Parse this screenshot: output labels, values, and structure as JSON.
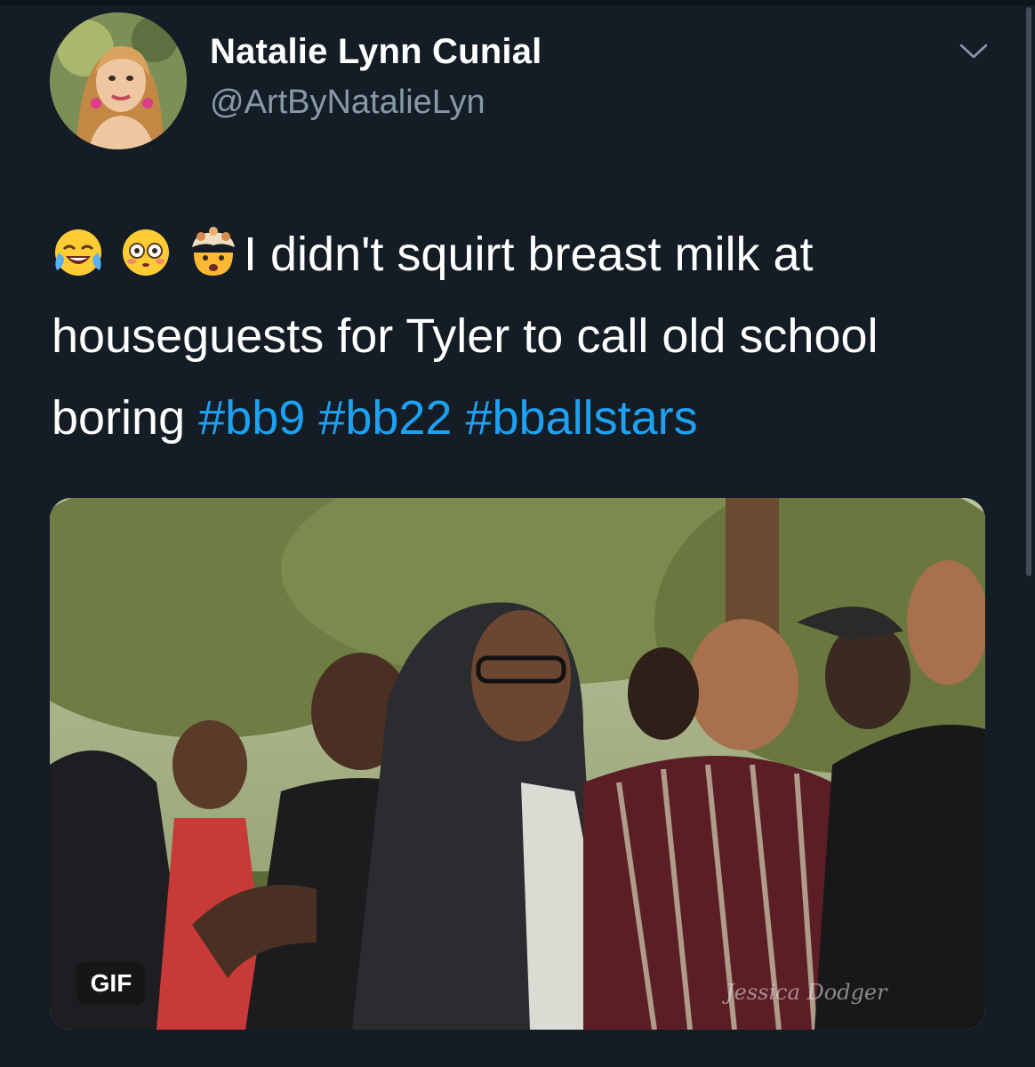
{
  "author": {
    "display_name": "Natalie Lynn Cunial",
    "handle": "@ArtByNatalieLyn",
    "avatar_icon": "avatar-photo"
  },
  "menu": {
    "icon": "chevron-down-icon"
  },
  "tweet": {
    "emojis": [
      "face-with-tears-of-joy",
      "flushed-face",
      "exploding-head"
    ],
    "text_line": "I didn't squirt breast milk at houseguests for Tyler to call old school boring",
    "hashtags": [
      "#bb9",
      "#bb22",
      "#bballstars"
    ]
  },
  "media": {
    "badge": "GIF",
    "watermark": "Jessica Dodger"
  },
  "colors": {
    "background": "#141d26",
    "link": "#1da1f2",
    "secondary_text": "#8899a6"
  }
}
